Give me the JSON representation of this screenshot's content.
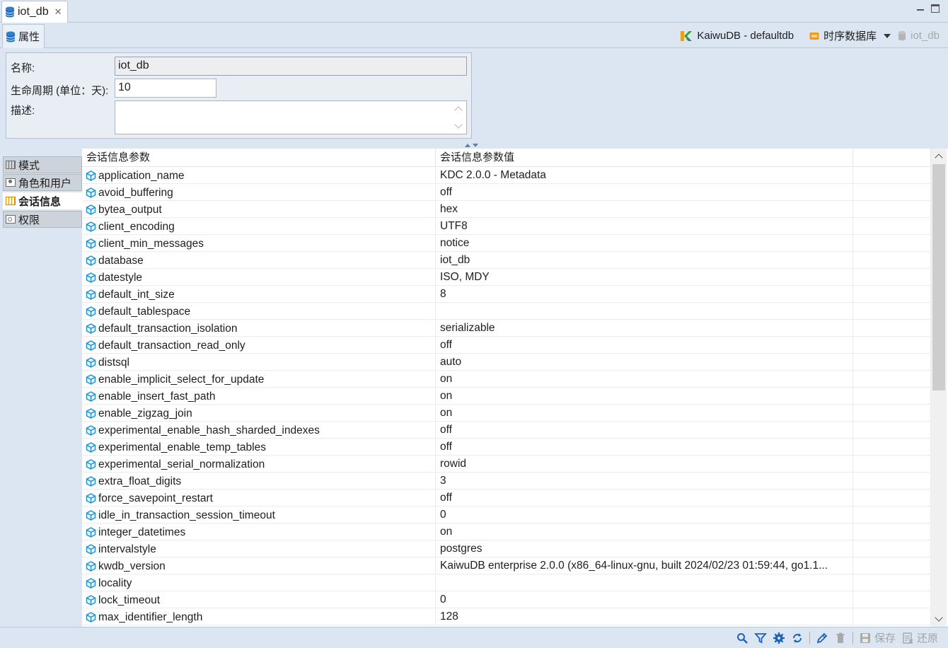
{
  "editor_tab": {
    "label": "iot_db",
    "icon": "database-icon",
    "close": "✕"
  },
  "properties_tab": {
    "label": "属性",
    "icon": "database-icon"
  },
  "breadcrumb": {
    "connection": "KaiwuDB - defaultdb",
    "connection_icon": "kaiwudb-logo",
    "category": "时序数据库",
    "category_icon": "ts-database-icon",
    "current": "iot_db"
  },
  "form": {
    "name_label": "名称:",
    "name_value": "iot_db",
    "lifetime_label": "生命周期 (单位：天):",
    "lifetime_value": "10",
    "desc_label": "描述:",
    "desc_value": ""
  },
  "side_tabs": [
    {
      "label": "模式",
      "icon": "schema-icon",
      "selected": false
    },
    {
      "label": "角色和用户",
      "icon": "user-icon",
      "selected": false
    },
    {
      "label": "会话信息",
      "icon": "session-icon",
      "selected": true
    },
    {
      "label": "权限",
      "icon": "key-icon",
      "selected": false
    }
  ],
  "table": {
    "columns": [
      "会话信息参数",
      "会话信息参数值"
    ],
    "rows": [
      [
        "application_name",
        "KDC 2.0.0 - Metadata"
      ],
      [
        "avoid_buffering",
        "off"
      ],
      [
        "bytea_output",
        "hex"
      ],
      [
        "client_encoding",
        "UTF8"
      ],
      [
        "client_min_messages",
        "notice"
      ],
      [
        "database",
        "iot_db"
      ],
      [
        "datestyle",
        "ISO, MDY"
      ],
      [
        "default_int_size",
        "8"
      ],
      [
        "default_tablespace",
        ""
      ],
      [
        "default_transaction_isolation",
        "serializable"
      ],
      [
        "default_transaction_read_only",
        "off"
      ],
      [
        "distsql",
        "auto"
      ],
      [
        "enable_implicit_select_for_update",
        "on"
      ],
      [
        "enable_insert_fast_path",
        "on"
      ],
      [
        "enable_zigzag_join",
        "on"
      ],
      [
        "experimental_enable_hash_sharded_indexes",
        "off"
      ],
      [
        "experimental_enable_temp_tables",
        "off"
      ],
      [
        "experimental_serial_normalization",
        "rowid"
      ],
      [
        "extra_float_digits",
        "3"
      ],
      [
        "force_savepoint_restart",
        "off"
      ],
      [
        "idle_in_transaction_session_timeout",
        "0"
      ],
      [
        "integer_datetimes",
        "on"
      ],
      [
        "intervalstyle",
        "postgres"
      ],
      [
        "kwdb_version",
        "KaiwuDB enterprise 2.0.0 (x86_64-linux-gnu, built 2024/02/23 01:59:44, go1.1..."
      ],
      [
        "locality",
        ""
      ],
      [
        "lock_timeout",
        "0"
      ],
      [
        "max_identifier_length",
        "128"
      ]
    ]
  },
  "bottom_toolbar": {
    "save_label": "保存",
    "revert_label": "还原"
  },
  "colors": {
    "chrome_bg": "#dce6f2",
    "cube_icon": "#1a8fd0",
    "accent_orange": "#e08a00"
  }
}
